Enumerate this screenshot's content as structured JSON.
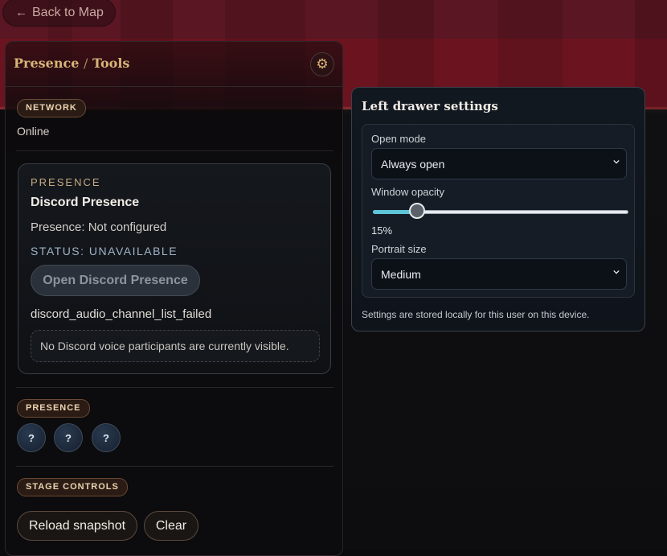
{
  "back_button": {
    "arrow": "←",
    "label": "Back to Map"
  },
  "drawer": {
    "title_part1": "Presence",
    "title_sep": "/",
    "title_part2": "Tools",
    "gear_glyph": "⚙",
    "network": {
      "badge": "NETWORK",
      "status": "Online"
    },
    "presence_card": {
      "eyebrow": "PRESENCE",
      "title": "Discord Presence",
      "presence_line": "Presence: Not configured",
      "status": "STATUS: UNAVAILABLE",
      "open_button": "Open Discord Presence",
      "error_code": "discord_audio_channel_list_failed",
      "empty_message": "No Discord voice participants are currently visible."
    },
    "presence_section": {
      "badge": "PRESENCE",
      "avatars": [
        "?",
        "?",
        "?"
      ]
    },
    "stage_controls": {
      "badge": "STAGE CONTROLS",
      "reload_button": "Reload snapshot",
      "clear_button": "Clear"
    }
  },
  "settings": {
    "title": "Left drawer settings",
    "open_mode": {
      "label": "Open mode",
      "value": "Always open"
    },
    "window_opacity": {
      "label": "Window opacity",
      "value_text": "15%",
      "value": 15,
      "min": 0,
      "max": 100
    },
    "portrait_size": {
      "label": "Portrait size",
      "value": "Medium"
    },
    "note": "Settings are stored locally for this user on this device."
  },
  "colors": {
    "accent_gold": "#d7b577",
    "slider_fill": "#5ec4d8",
    "curtain_red": "#6b1420"
  }
}
